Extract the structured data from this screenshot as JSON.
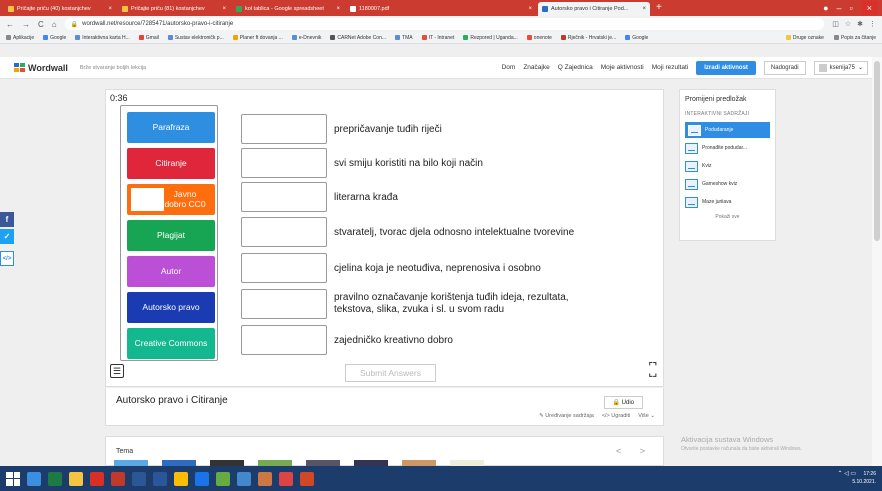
{
  "browser": {
    "tabs": [
      {
        "title": "Pričajte priču (40) kostanjchev"
      },
      {
        "title": "Pričajte priču (81) kostanjchev"
      },
      {
        "title": "kol tablica - Google spreadsheet"
      },
      {
        "title": "1180007.pdf"
      },
      {
        "title": "Autorsko pravo i Citiranje Pod..."
      }
    ],
    "new_tab": "+",
    "url": "wordwall.net/resource/7285471/autorsko-pravo-i-citiranje",
    "nav_icons": [
      "←",
      "→",
      "C",
      "⌂"
    ],
    "bookmarks": [
      "Aplikacije",
      "Google",
      "Interaktivna karta H...",
      "Gmail",
      "Sustav elektroničk p...",
      "Planer ft dovanja ...",
      "e-Dnevnik",
      "CARNet Adobe Con...",
      "TMA",
      "IT - Intranet",
      "Rezpored | Uganda...",
      "onenote",
      "Rječnik - Hrvatski je...",
      "Google"
    ],
    "bookmarks_right": [
      "Druge oznake",
      "Popis za čitanje"
    ]
  },
  "header": {
    "logo": "Wordwall",
    "slogan": "Brže stvaranje boljih lekcija",
    "nav": [
      "Dom",
      "Značajke",
      "Q Zajednica",
      "Moje aktivnosti",
      "Moji rezultati"
    ],
    "create": "Izradi aktivnost",
    "upgrade": "Nadogradi",
    "user": "ksenija75"
  },
  "game": {
    "timer": "0:36",
    "keys": [
      "Parafraza",
      "Citiranje",
      "Javno dobro CC0",
      "Plagijat",
      "Autor",
      "Autorsko pravo",
      "Creative Commons"
    ],
    "definitions": [
      "prepričavanje tuđih riječi",
      "svi smiju koristiti na bilo koji način",
      "literarna krađa",
      "stvaratelj, tvorac djela odnosno intelektualne tvorevine",
      "cjelina koja je neotuđiva, neprenosiva i osobno",
      "pravilno označavanje korištenja tuđih ideja, rezultata, tekstova, slika, zvuka i sl. u svom radu",
      "zajedničko kreativno dobro"
    ],
    "submit": "Submit Answers"
  },
  "right_panel": {
    "title": "Promijeni predložak",
    "section": "INTERAKTIVNI SADRŽAJI",
    "items": [
      "Podudaranje",
      "Pronađite podudar...",
      "Kviz",
      "Gameshow kviz",
      "Maze juriiava"
    ],
    "more": "Pokaži sve"
  },
  "info": {
    "title": "Autorsko pravo i Citiranje",
    "share": "Udio",
    "links": [
      "Uređivanje sadržaja",
      "Ugraditi",
      "Više"
    ]
  },
  "theme": {
    "label": "Tema",
    "nav": "< >"
  },
  "activation": {
    "title": "Aktivacija sustava Windows",
    "sub": "Otvorite postavke računala da biste aktivirali Windows."
  },
  "taskbar": {
    "time": "17:26",
    "date": "5.10.2021."
  }
}
